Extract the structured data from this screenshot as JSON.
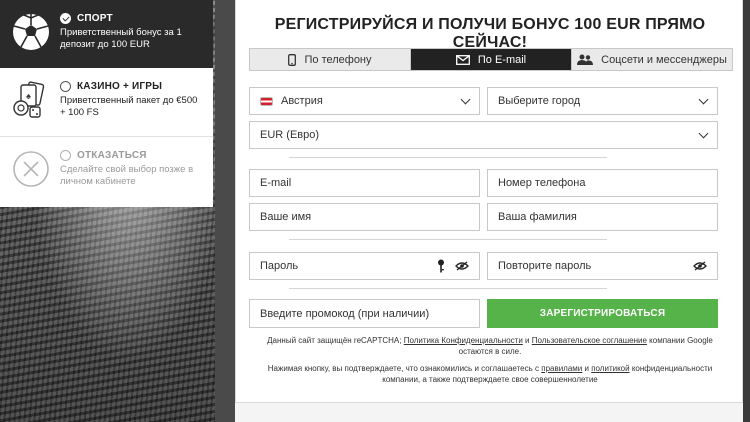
{
  "offers": [
    {
      "title": "СПОРТ",
      "desc": "Приветственный бонус за 1 депозит до 100 EUR",
      "selected": true
    },
    {
      "title": "КАЗИНО + ИГРЫ",
      "desc": "Приветственный пакет до €500 + 100 FS",
      "selected": false
    },
    {
      "title": "ОТКАЗАТЬСЯ",
      "desc": "Сделайте свой выбор позже в личном кабинете",
      "selected": false
    }
  ],
  "headline": "РЕГИСТРИРУЙСЯ И ПОЛУЧИ БОНУС 100 EUR ПРЯМО СЕЙЧАС!",
  "tabs": [
    {
      "label": "По телефону",
      "icon": "phone-icon"
    },
    {
      "label": "По E-mail",
      "icon": "envelope-icon"
    },
    {
      "label": "Соцсети и мессенджеры",
      "icon": "users-icon"
    }
  ],
  "form": {
    "country": "Австрия",
    "city_placeholder": "Выберите город",
    "currency": "EUR (Евро)",
    "email_placeholder": "E-mail",
    "phone_placeholder": "Номер телефона",
    "firstname_placeholder": "Ваше имя",
    "lastname_placeholder": "Ваша фамилия",
    "password_placeholder": "Пароль",
    "password_repeat_placeholder": "Повторите пароль",
    "promo_placeholder": "Введите промокод (при наличии)",
    "register_label": "ЗАРЕГИСТРИРОВАТЬСЯ"
  },
  "notes": {
    "recaptcha_prefix": "Данный сайт защищён reCAPTCHA; ",
    "privacy_link": "Политика Конфиденциальности",
    "and": " и ",
    "terms_link": "Пользовательское соглашение",
    "recaptcha_suffix": " компании Google остаются в силе.",
    "agree_prefix": "Нажимая кнопку, вы подтверждаете, что ознакомились и соглашаетесь с ",
    "rules_link": "правилами",
    "and2": " и ",
    "policy_link": "политикой",
    "agree_suffix": " конфиденциальности компании, а также подтверждаете свое совершеннолетие"
  },
  "colors": {
    "accent_green": "#55b34a",
    "dark": "#222222"
  }
}
